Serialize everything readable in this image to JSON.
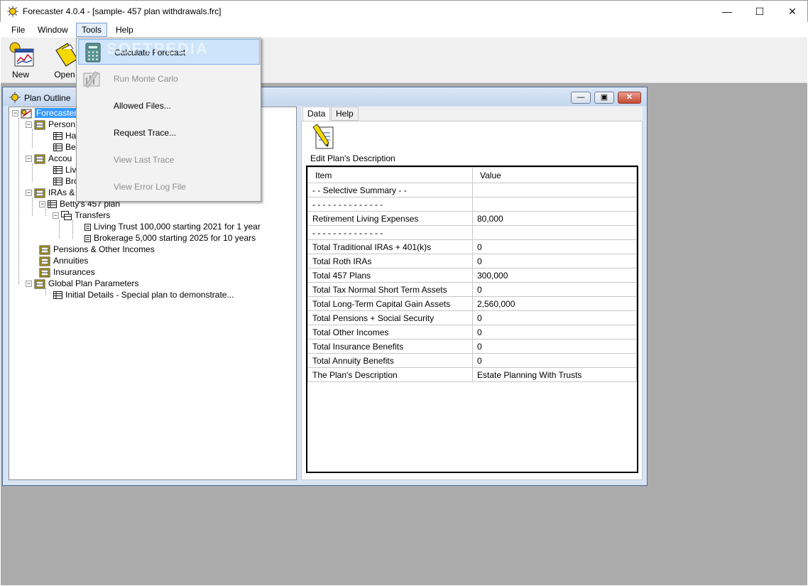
{
  "window": {
    "title": "Forecaster 4.0.4 - [sample- 457 plan withdrawals.frc]"
  },
  "menubar": {
    "items": [
      "File",
      "Window",
      "Tools",
      "Help"
    ]
  },
  "toolbar": {
    "new_label": "New",
    "open_label": "Open"
  },
  "tools_menu": {
    "items": [
      {
        "label": "Calculate Forecast",
        "enabled": true,
        "highlighted": true,
        "icon": "calculator-icon"
      },
      {
        "label": "Run Monte Carlo",
        "enabled": false,
        "icon": "monte-carlo-icon"
      },
      {
        "label": "Allowed Files...",
        "enabled": true
      },
      {
        "label": "Request Trace...",
        "enabled": true
      },
      {
        "label": "View Last Trace",
        "enabled": false
      },
      {
        "label": "View Error Log File",
        "enabled": false
      }
    ]
  },
  "watermark": "SOFTPEDIA",
  "plan_outline": {
    "title": "Plan Outline",
    "tree": [
      {
        "label": "Forecaster",
        "selected": true
      },
      {
        "label": "Person"
      },
      {
        "label": "Ha"
      },
      {
        "label": "Be"
      },
      {
        "label": "Accou"
      },
      {
        "label": "Liv"
      },
      {
        "label": "Bro"
      },
      {
        "label": "IRAs &"
      },
      {
        "label": "Betty's 457 plan"
      },
      {
        "label": "Transfers"
      },
      {
        "label": "Living Trust 100,000 starting 2021 for 1 year"
      },
      {
        "label": "Brokerage 5,000 starting 2025 for 10 years"
      },
      {
        "label": "Pensions & Other Incomes"
      },
      {
        "label": "Annuities"
      },
      {
        "label": "Insurances"
      },
      {
        "label": "Global Plan Parameters"
      },
      {
        "label": "Initial Details - Special plan to demonstrate..."
      }
    ]
  },
  "tabs": {
    "data": "Data",
    "help": "Help"
  },
  "edit_description": {
    "label": "Edit Plan's Description"
  },
  "summary_table": {
    "headers": [
      "Item",
      "Value"
    ],
    "rows": [
      [
        "- - Selective Summary - -",
        ""
      ],
      [
        "- - - - - - - - - - - - - -",
        ""
      ],
      [
        "Retirement Living Expenses",
        "80,000"
      ],
      [
        "- - - - - - - - - - - - - -",
        ""
      ],
      [
        "Total Traditional IRAs + 401(k)s",
        "0"
      ],
      [
        "Total Roth IRAs",
        "0"
      ],
      [
        "Total 457 Plans",
        "300,000"
      ],
      [
        "Total Tax Normal Short Term Assets",
        "0"
      ],
      [
        "Total Long-Term Capital Gain Assets",
        "2,560,000"
      ],
      [
        "Total Pensions + Social Security",
        "0"
      ],
      [
        "Total Other Incomes",
        "0"
      ],
      [
        "Total Insurance Benefits",
        "0"
      ],
      [
        "Total Annuity Benefits",
        "0"
      ],
      [
        "The Plan's Description",
        "Estate Planning With Trusts"
      ]
    ]
  },
  "colors": {
    "selection": "#3399ff",
    "menu_highlight": "#cde4fb",
    "mdi_background": "#ababab"
  }
}
